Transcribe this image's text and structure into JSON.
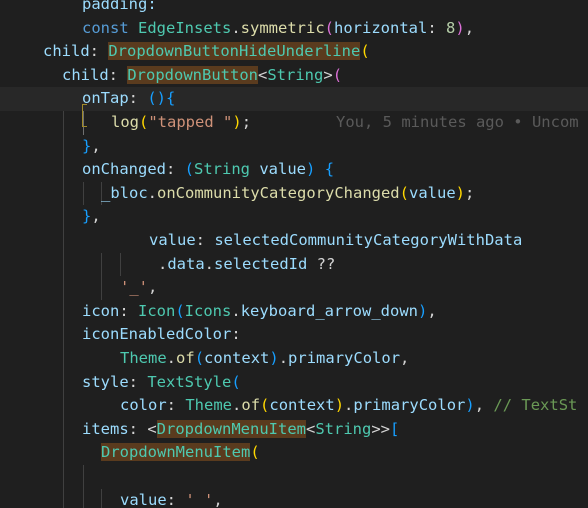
{
  "editor": {
    "blame_annotation": "You, 5 minutes ago • Uncom",
    "lines": [
      [
        {
          "t": "padding:",
          "c": "prm"
        }
      ],
      [
        {
          "t": "const ",
          "c": "kw"
        },
        {
          "t": "EdgeInsets",
          "c": "cls"
        },
        {
          "t": ".",
          "c": "pn"
        },
        {
          "t": "symmetric",
          "c": "fn"
        },
        {
          "t": "(",
          "c": "m"
        },
        {
          "t": "horizontal",
          "c": "prm"
        },
        {
          "t": ": ",
          "c": "pn"
        },
        {
          "t": "8",
          "c": "num"
        },
        {
          "t": ")",
          "c": "m"
        },
        {
          "t": ",",
          "c": "pn"
        }
      ],
      [
        {
          "t": "child",
          "c": "prm"
        },
        {
          "t": ": ",
          "c": "pn"
        },
        {
          "t": "DropdownButtonHideUnderline",
          "c": "cls hl"
        },
        {
          "t": "(",
          "c": "y"
        }
      ],
      [
        {
          "t": "child",
          "c": "prm"
        },
        {
          "t": ": ",
          "c": "pn"
        },
        {
          "t": "DropdownButton",
          "c": "cls hl"
        },
        {
          "t": "<",
          "c": "pn"
        },
        {
          "t": "String",
          "c": "cls"
        },
        {
          "t": ">",
          "c": "pn"
        },
        {
          "t": "(",
          "c": "m"
        }
      ],
      [
        {
          "t": "onTap",
          "c": "prm"
        },
        {
          "t": ": ",
          "c": "pn"
        },
        {
          "t": "()",
          "c": "b"
        },
        {
          "t": "{",
          "c": "b"
        }
      ],
      [
        {
          "t": "log",
          "c": "fn"
        },
        {
          "t": "(",
          "c": "y"
        },
        {
          "t": "\"tapped \"",
          "c": "str"
        },
        {
          "t": ")",
          "c": "y"
        },
        {
          "t": ";",
          "c": "pn"
        }
      ],
      [
        {
          "t": "}",
          "c": "b"
        },
        {
          "t": ",",
          "c": "pn"
        }
      ],
      [
        {
          "t": "onChanged",
          "c": "prm"
        },
        {
          "t": ": ",
          "c": "pn"
        },
        {
          "t": "(",
          "c": "b"
        },
        {
          "t": "String ",
          "c": "cls"
        },
        {
          "t": "value",
          "c": "prm"
        },
        {
          "t": ")",
          "c": "b"
        },
        {
          "t": " {",
          "c": "b"
        }
      ],
      [
        {
          "t": "_bloc",
          "c": "prm"
        },
        {
          "t": ".",
          "c": "pn"
        },
        {
          "t": "onCommunityCategoryChanged",
          "c": "fn"
        },
        {
          "t": "(",
          "c": "y"
        },
        {
          "t": "value",
          "c": "prm"
        },
        {
          "t": ")",
          "c": "y"
        },
        {
          "t": ";",
          "c": "pn"
        }
      ],
      [
        {
          "t": "}",
          "c": "b"
        },
        {
          "t": ",",
          "c": "pn"
        }
      ],
      [
        {
          "t": "value",
          "c": "prm"
        },
        {
          "t": ": ",
          "c": "pn"
        },
        {
          "t": "selectedCommunityCategoryWithData",
          "c": "prm"
        }
      ],
      [
        {
          "t": ".",
          "c": "pn"
        },
        {
          "t": "data",
          "c": "prm"
        },
        {
          "t": ".",
          "c": "pn"
        },
        {
          "t": "selectedId",
          "c": "prm"
        },
        {
          "t": " ??",
          "c": "pn"
        }
      ],
      [
        {
          "t": "'_'",
          "c": "str"
        },
        {
          "t": ",",
          "c": "pn"
        }
      ],
      [
        {
          "t": "icon",
          "c": "prm"
        },
        {
          "t": ": ",
          "c": "pn"
        },
        {
          "t": "Icon",
          "c": "cls"
        },
        {
          "t": "(",
          "c": "b"
        },
        {
          "t": "Icons",
          "c": "cls"
        },
        {
          "t": ".",
          "c": "pn"
        },
        {
          "t": "keyboard_arrow_down",
          "c": "prm"
        },
        {
          "t": ")",
          "c": "b"
        },
        {
          "t": ",",
          "c": "pn"
        }
      ],
      [
        {
          "t": "iconEnabledColor",
          "c": "prm"
        },
        {
          "t": ":",
          "c": "pn"
        }
      ],
      [
        {
          "t": "Theme",
          "c": "cls"
        },
        {
          "t": ".",
          "c": "pn"
        },
        {
          "t": "of",
          "c": "fn"
        },
        {
          "t": "(",
          "c": "b"
        },
        {
          "t": "context",
          "c": "prm"
        },
        {
          "t": ")",
          "c": "b"
        },
        {
          "t": ".",
          "c": "pn"
        },
        {
          "t": "primaryColor",
          "c": "prm"
        },
        {
          "t": ",",
          "c": "pn"
        }
      ],
      [
        {
          "t": "style",
          "c": "prm"
        },
        {
          "t": ": ",
          "c": "pn"
        },
        {
          "t": "TextStyle",
          "c": "cls"
        },
        {
          "t": "(",
          "c": "b"
        }
      ],
      [
        {
          "t": "color",
          "c": "prm"
        },
        {
          "t": ": ",
          "c": "pn"
        },
        {
          "t": "Theme",
          "c": "cls"
        },
        {
          "t": ".",
          "c": "pn"
        },
        {
          "t": "of",
          "c": "fn"
        },
        {
          "t": "(",
          "c": "y"
        },
        {
          "t": "context",
          "c": "prm"
        },
        {
          "t": ")",
          "c": "y"
        },
        {
          "t": ".",
          "c": "pn"
        },
        {
          "t": "primaryColor",
          "c": "prm"
        },
        {
          "t": ")",
          "c": "b"
        },
        {
          "t": ", ",
          "c": "pn"
        },
        {
          "t": "// TextSt",
          "c": "cm"
        }
      ],
      [
        {
          "t": "items",
          "c": "prm"
        },
        {
          "t": ": <",
          "c": "pn"
        },
        {
          "t": "DropdownMenuItem",
          "c": "cls hl"
        },
        {
          "t": "<",
          "c": "pn"
        },
        {
          "t": "String",
          "c": "cls"
        },
        {
          "t": ">>",
          "c": "pn"
        },
        {
          "t": "[",
          "c": "b"
        }
      ],
      [
        {
          "t": "DropdownMenuItem",
          "c": "cls hl"
        },
        {
          "t": "(",
          "c": "y"
        }
      ],
      [],
      [
        {
          "t": "value",
          "c": "prm"
        },
        {
          "t": ": ",
          "c": "pn"
        },
        {
          "t": "'_'",
          "c": "str"
        },
        {
          "t": ",",
          "c": "pn"
        }
      ]
    ]
  }
}
